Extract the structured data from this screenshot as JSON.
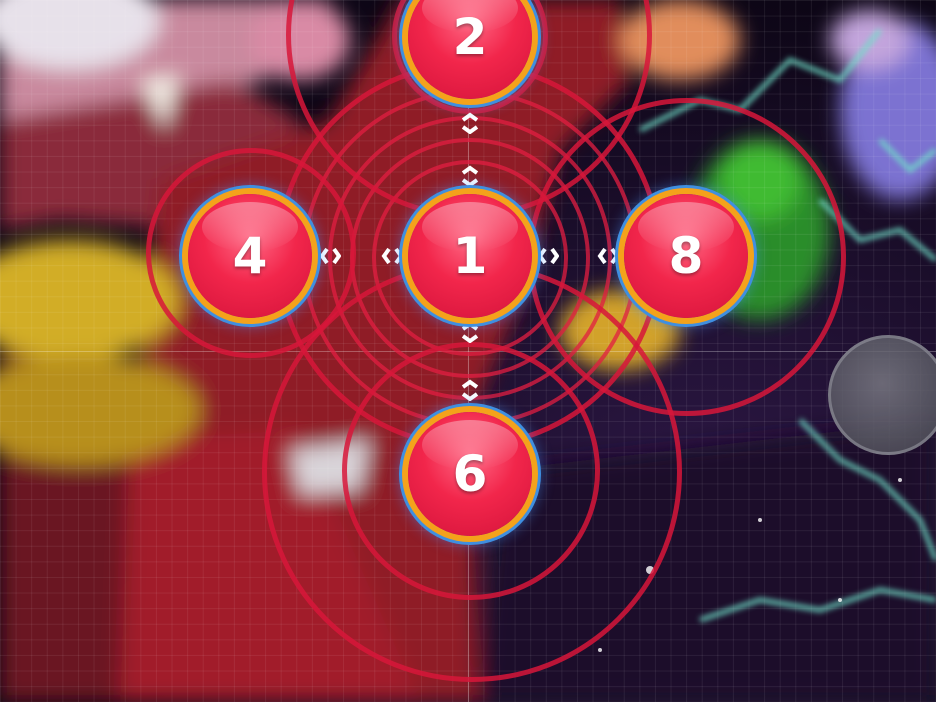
{
  "playfield": {
    "hit_circles": [
      {
        "label": "1",
        "role": "center"
      },
      {
        "label": "2",
        "role": "top"
      },
      {
        "label": "4",
        "role": "left"
      },
      {
        "label": "8",
        "role": "right"
      },
      {
        "label": "6",
        "role": "bottom"
      }
    ],
    "colors": {
      "circle_fill": "#f2264b",
      "circle_border": "#f4a21b",
      "circle_glow": "#3f8fe0",
      "approach_ring": "#d7163a",
      "follow_arrow": "#ffffff"
    },
    "arrow_icon": "chevron-arrow-icon"
  },
  "controls": {
    "on_screen_button_icon": "touch-button-icon"
  }
}
